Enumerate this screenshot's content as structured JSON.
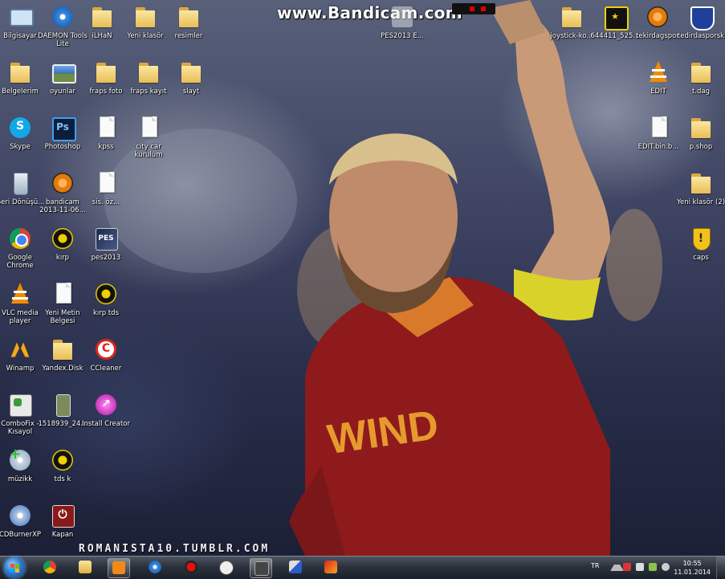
{
  "overlay": {
    "watermark": "www.Bandicam.com",
    "wallpaper_caption": "ROMANISTA10.TUMBLR.COM"
  },
  "desktop": {
    "icons": [
      {
        "label": "Bilgisayar",
        "icon": "computer-icon"
      },
      {
        "label": "DAEMON Tools Lite",
        "icon": "daemon-tools-icon"
      },
      {
        "label": "iLHaN",
        "icon": "user-folder-icon"
      },
      {
        "label": "Yeni klasör",
        "icon": "folder-icon"
      },
      {
        "label": "resimler",
        "icon": "folder-icon"
      },
      {
        "label": "PES2013 E...",
        "icon": "shortcut-icon"
      },
      {
        "label": "joystick-ko...",
        "icon": "folder-icon"
      },
      {
        "label": "644411_525...",
        "icon": "image-icon"
      },
      {
        "label": "tekirdagspor",
        "icon": "club-logo-icon"
      },
      {
        "label": "tedirdasporsk",
        "icon": "club-crest-icon"
      },
      {
        "label": "Belgelerim",
        "icon": "documents-icon"
      },
      {
        "label": "oyunlar",
        "icon": "image-icon"
      },
      {
        "label": "fraps foto",
        "icon": "folder-icon"
      },
      {
        "label": "fraps kayıt",
        "icon": "folder-icon"
      },
      {
        "label": "slayt",
        "icon": "folder-icon"
      },
      {
        "label": "EDIT",
        "icon": "vlc-icon"
      },
      {
        "label": "t.dag",
        "icon": "folder-icon"
      },
      {
        "label": "Skype",
        "icon": "skype-icon"
      },
      {
        "label": "Photoshop",
        "icon": "photoshop-icon"
      },
      {
        "label": "kpss",
        "icon": "document-icon"
      },
      {
        "label": "city car kurulum",
        "icon": "document-icon"
      },
      {
        "label": "EDIT.bin.b...",
        "icon": "document-icon"
      },
      {
        "label": "p.shop",
        "icon": "folder-icon"
      },
      {
        "label": "Geri Dönüşü...",
        "icon": "recycle-bin-icon"
      },
      {
        "label": "bandicam 2013-11-06...",
        "icon": "club-logo-icon"
      },
      {
        "label": "sis. öz...",
        "icon": "document-icon"
      },
      {
        "label": "Yeni klasör (2)",
        "icon": "folder-icon"
      },
      {
        "label": "Google Chrome",
        "icon": "chrome-icon"
      },
      {
        "label": "kırp",
        "icon": "club-logo-icon"
      },
      {
        "label": "pes2013",
        "icon": "pes-icon"
      },
      {
        "label": "caps",
        "icon": "warning-shield-icon"
      },
      {
        "label": "VLC media player",
        "icon": "vlc-icon"
      },
      {
        "label": "Yeni Metin Belgesi",
        "icon": "document-icon"
      },
      {
        "label": "kırp tds",
        "icon": "club-logo-icon"
      },
      {
        "label": "Winamp",
        "icon": "winamp-icon"
      },
      {
        "label": "Yandex.Disk",
        "icon": "yandex-disk-icon"
      },
      {
        "label": "CCleaner",
        "icon": "ccleaner-icon"
      },
      {
        "label": "ComboFix - Kısayol",
        "icon": "combofix-icon"
      },
      {
        "label": "1518939_24...",
        "icon": "image-icon"
      },
      {
        "label": "Install Creator",
        "icon": "install-creator-icon"
      },
      {
        "label": "müzikk",
        "icon": "music-disc-icon"
      },
      {
        "label": "tds k",
        "icon": "club-logo-icon"
      },
      {
        "label": "CDBurnerXP",
        "icon": "cdburner-icon"
      },
      {
        "label": "Kapan",
        "icon": "shutdown-icon"
      }
    ]
  },
  "taskbar": {
    "pinned": [
      {
        "name": "chrome",
        "icon": "chrome-icon"
      },
      {
        "name": "explorer",
        "icon": "folder-icon"
      },
      {
        "name": "media-player",
        "icon": "media-player-icon"
      },
      {
        "name": "daemon-tools",
        "icon": "daemon-tools-icon"
      },
      {
        "name": "bandicam",
        "icon": "record-icon"
      },
      {
        "name": "troll",
        "icon": "face-icon"
      },
      {
        "name": "game",
        "icon": "game-icon"
      },
      {
        "name": "pen",
        "icon": "pen-icon"
      },
      {
        "name": "tool",
        "icon": "tool-icon"
      }
    ],
    "language": "TR",
    "time": "10:55",
    "date": "11.01.2014"
  }
}
